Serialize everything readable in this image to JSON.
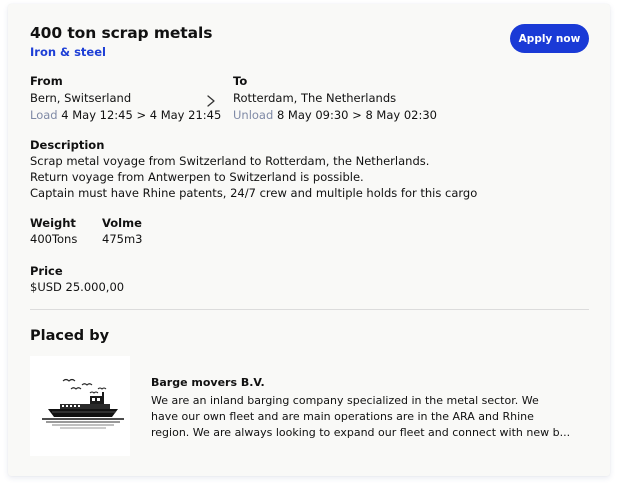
{
  "listing": {
    "title": "400 ton scrap metals",
    "category": "Iron & steel",
    "apply_label": "Apply now"
  },
  "route": {
    "from_label": "From",
    "from_location": "Bern, Switserland",
    "load_label": "Load",
    "load_window": "4 May 12:45 > 4 May 21:45",
    "to_label": "To",
    "to_location": "Rotterdam, The Netherlands",
    "unload_label": "Unload",
    "unload_window": "8 May 09:30 > 8 May 02:30",
    "arrow_icon": "chevron-right-icon"
  },
  "description": {
    "label": "Description",
    "lines": [
      "Scrap metal voyage from Switzerland to Rotterdam, the Netherlands.",
      "Return voyage from Antwerpen to Switzerland is possible.",
      "Captain must have Rhine patents, 24/7 crew and multiple holds for this cargo"
    ]
  },
  "specs": {
    "weight_label": "Weight",
    "weight_value": "400Tons",
    "volume_label": "Volme",
    "volume_value": "475m3"
  },
  "price": {
    "label": "Price",
    "value": "$USD 25.000,00"
  },
  "placed_by": {
    "heading": "Placed by",
    "company_name": "Barge movers B.V.",
    "logo_icon": "barge-ship-logo",
    "description_lines": [
      "We are an inland barging company specialized in the metal sector. We",
      "have our own fleet and are main operations are in the ARA and Rhine",
      "region. We are always looking to expand our fleet and connect with new b..."
    ]
  },
  "colors": {
    "accent": "#1a3ad6",
    "category_text": "#1e3fd6",
    "muted_text": "#7f8aa6",
    "card_background": "#f9f9f7"
  }
}
